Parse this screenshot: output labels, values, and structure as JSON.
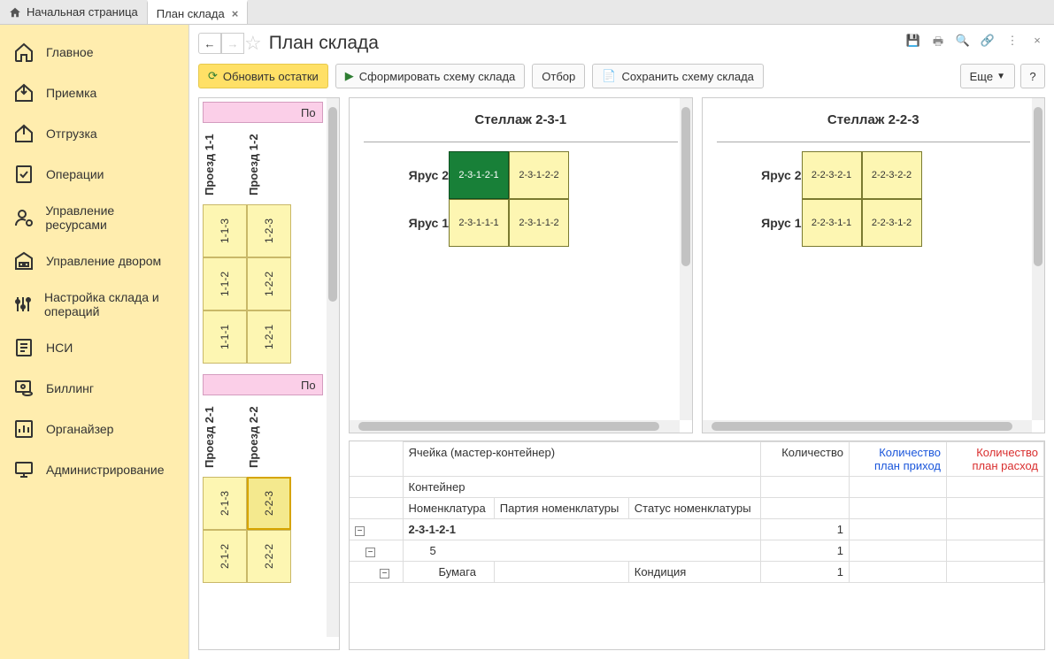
{
  "tabs": {
    "home": "Начальная страница",
    "current": "План склада"
  },
  "sidebar": {
    "items": [
      {
        "label": "Главное"
      },
      {
        "label": "Приемка"
      },
      {
        "label": "Отгрузка"
      },
      {
        "label": "Операции"
      },
      {
        "label": "Управление ресурсами"
      },
      {
        "label": "Управление двором"
      },
      {
        "label": "Настройка склада и операций"
      },
      {
        "label": "НСИ"
      },
      {
        "label": "Биллинг"
      },
      {
        "label": "Органайзер"
      },
      {
        "label": "Администрирование"
      }
    ]
  },
  "page": {
    "title": "План склада"
  },
  "toolbar": {
    "refresh": "Обновить остатки",
    "form": "Сформировать схему склада",
    "filter": "Отбор",
    "save": "Сохранить схему склада",
    "more": "Еще",
    "help": "?"
  },
  "left": {
    "zone1_header": "По",
    "zone2_header": "По",
    "aisle_1_1": "Проезд 1-1",
    "aisle_1_2": "Проезд 1-2",
    "aisle_2_1": "Проезд 2-1",
    "aisle_2_2": "Проезд 2-2",
    "cells1": [
      [
        "1-1-3",
        "1-2-3"
      ],
      [
        "1-1-2",
        "1-2-2"
      ],
      [
        "1-1-1",
        "1-2-1"
      ]
    ],
    "cells2": [
      [
        "2-1-3",
        "2-2-3"
      ],
      [
        "2-1-2",
        "2-2-2"
      ]
    ]
  },
  "rack_left": {
    "title": "Стеллаж 2-3-1",
    "tier2": "Ярус 2",
    "tier1": "Ярус 1",
    "cells": {
      "t2c1": "2-3-1-2-1",
      "t2c2": "2-3-1-2-2",
      "t1c1": "2-3-1-1-1",
      "t1c2": "2-3-1-1-2"
    }
  },
  "rack_right": {
    "title": "Стеллаж 2-2-3",
    "tier2": "Ярус 2",
    "tier1": "Ярус 1",
    "cells": {
      "t2c1": "2-2-3-2-1",
      "t2c2": "2-2-3-2-2",
      "t1c1": "2-2-3-1-1",
      "t1c2": "2-2-3-1-2"
    }
  },
  "table": {
    "h_cell": "Ячейка (мастер-контейнер)",
    "h_qty": "Количество",
    "h_qty_in": "Количество план приход",
    "h_qty_out": "Количество план расход",
    "h_container": "Контейнер",
    "h_nomen": "Номенклатура",
    "h_batch": "Партия номенклатуры",
    "h_status": "Статус номенклатуры",
    "r1_cell": "2-3-1-2-1",
    "r1_qty": "1",
    "r2_container": "5",
    "r2_qty": "1",
    "r3_nomen": "Бумага",
    "r3_status": "Кондиция",
    "r3_qty": "1"
  }
}
